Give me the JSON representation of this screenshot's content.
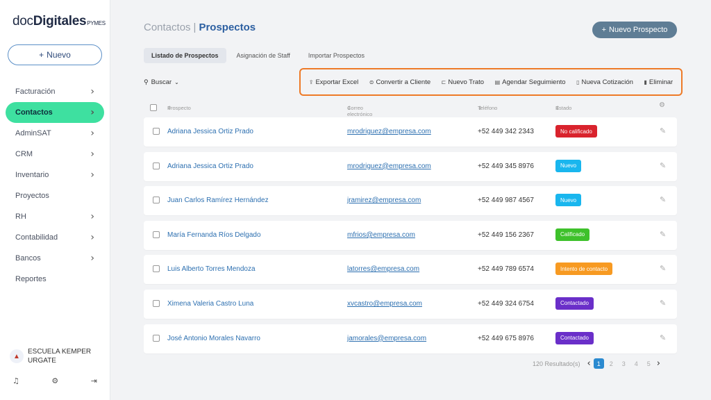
{
  "brand": {
    "main": "doc",
    "bold": "Digitales",
    "sub": "PYMES"
  },
  "sidebar": {
    "new_button": "Nuevo",
    "items": [
      {
        "label": "Facturación",
        "chevron": true
      },
      {
        "label": "Contactos",
        "chevron": true,
        "active": true
      },
      {
        "label": "AdminSAT",
        "chevron": true
      },
      {
        "label": "CRM",
        "chevron": true
      },
      {
        "label": "Inventario",
        "chevron": true
      },
      {
        "label": "Proyectos",
        "chevron": false
      },
      {
        "label": "RH",
        "chevron": true
      },
      {
        "label": "Contabilidad",
        "chevron": true
      },
      {
        "label": "Bancos",
        "chevron": true
      },
      {
        "label": "Reportes",
        "chevron": false
      }
    ],
    "org_name": "ESCUELA KEMPER URGATE",
    "footer_icons": [
      "bell-icon",
      "gear-icon",
      "logout-icon"
    ]
  },
  "header": {
    "breadcrumb_parent": "Contactos",
    "breadcrumb_sep": "|",
    "breadcrumb_current": "Prospectos",
    "new_prospect": "Nuevo Prospecto"
  },
  "tabs": [
    "Listado de Prospectos",
    "Asignación de Staff",
    "Importar Prospectos"
  ],
  "search_label": "Buscar",
  "toolbar": {
    "export": "Exportar Excel",
    "convert": "Convertir a Cliente",
    "deal": "Nuevo Trato",
    "followup": "Agendar Seguimiento",
    "quote": "Nueva Cotización",
    "delete": "Eliminar"
  },
  "columns": {
    "prospect": "Prospecto",
    "email": "Correo electrónico",
    "phone": "Teléfono",
    "status": "Estado"
  },
  "rows": [
    {
      "name": "Adriana Jessica Ortiz Prado",
      "email": "mrodriguez@empresa.com",
      "phone": "+52 449 342 2343",
      "status": "No calificado",
      "color": "#d9232d"
    },
    {
      "name": "Adriana Jessica Ortiz Prado",
      "email": "mrodriguez@empresa.com",
      "phone": "+52 449 345 8976",
      "status": "Nuevo",
      "color": "#19b6ee"
    },
    {
      "name": "Juan Carlos Ramírez Hernández",
      "email": "jramirez@empresa.com",
      "phone": "+52 449 987 4567",
      "status": "Nuevo",
      "color": "#19b6ee"
    },
    {
      "name": "María Fernanda Ríos Delgado",
      "email": "mfrios@empresa.com",
      "phone": "+52 449 156 2367",
      "status": "Calificado",
      "color": "#3ec12b"
    },
    {
      "name": "Luis Alberto Torres Mendoza",
      "email": "latorres@empresa.com",
      "phone": "+52 449 789 6574",
      "status": "Intento de contacto",
      "color": "#f79a22"
    },
    {
      "name": "Ximena Valeria Castro Luna",
      "email": "xvcastro@empresa.com",
      "phone": "+52 449 324 6754",
      "status": "Contactado",
      "color": "#6a2fc9"
    },
    {
      "name": "José Antonio Morales Navarro",
      "email": "jamorales@empresa.com",
      "phone": "+52 449 675 8976",
      "status": "Contactado",
      "color": "#6a2fc9"
    }
  ],
  "pagination": {
    "results": "120 Resultado(s)",
    "pages": [
      "1",
      "2",
      "3",
      "4",
      "5"
    ],
    "current": "1"
  }
}
